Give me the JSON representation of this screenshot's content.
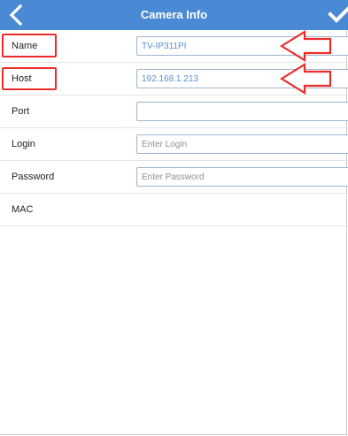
{
  "navbar": {
    "title": "Camera Info",
    "back_icon": "chevron-left-icon",
    "done_icon": "checkmark-icon",
    "color": "#4a89d4"
  },
  "form": {
    "name": {
      "label": "Name",
      "value": "TV-IP311PI",
      "placeholder": ""
    },
    "host": {
      "label": "Host",
      "value": "192.168.1.213",
      "placeholder": ""
    },
    "port": {
      "label": "Port",
      "value": "",
      "placeholder": ""
    },
    "login": {
      "label": "Login",
      "value": "",
      "placeholder": "Enter Login"
    },
    "password": {
      "label": "Password",
      "value": "",
      "placeholder": "Enter Password"
    },
    "mac": {
      "label": "MAC"
    }
  },
  "annotations": {
    "color": "#ee2b2b",
    "arrow_icon": "left-arrow-icon"
  }
}
